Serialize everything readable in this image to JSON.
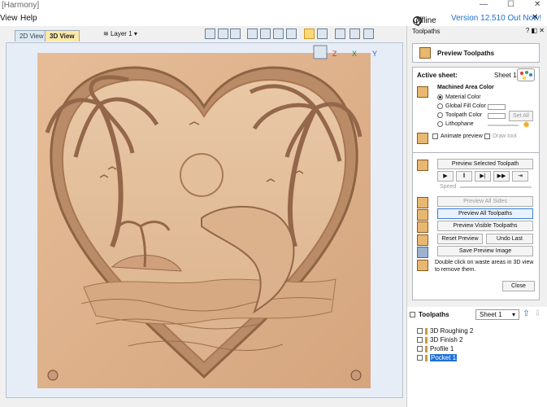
{
  "title": "[Harmony]",
  "menu": {
    "view": "View",
    "help": "Help"
  },
  "status": {
    "offline": "Offline",
    "version": "Version 12.510 Out Now!"
  },
  "tabs": {
    "view2d": "2D View",
    "view3d": "3D View"
  },
  "layer": "Layer 1",
  "panel": {
    "header": "Toolpaths",
    "title": "Preview Toolpaths",
    "active_sheet_label": "Active sheet:",
    "active_sheet_value": "Sheet 1",
    "machined_area_color": "Machined Area Color",
    "options": [
      "Material Color",
      "Global Fill Color",
      "Toolpath Color",
      "Lithophane"
    ],
    "set_all": "Set All",
    "animate_preview": "Animate preview",
    "draw_tool": "Draw tool",
    "preview_selected": "Preview Selected Toolpath",
    "speed": "Speed",
    "preview_all_sides": "Preview All Sides",
    "preview_all_toolpaths": "Preview All Toolpaths",
    "preview_visible": "Preview Visible Toolpaths",
    "reset_preview": "Reset Preview",
    "undo_last": "Undo Last",
    "save_preview_image": "Save Preview Image",
    "hint": "Double click on waste areas in 3D view to remove them.",
    "close": "Close"
  },
  "toolpaths": {
    "header": "Toolpaths",
    "sheet": "Sheet 1",
    "items": [
      "3D Roughing 2",
      "3D Finish 2",
      "Profile 1",
      "Pocket 1"
    ]
  },
  "axes": {
    "iso": "",
    "x": "X",
    "y": "Y",
    "z": "Z"
  }
}
